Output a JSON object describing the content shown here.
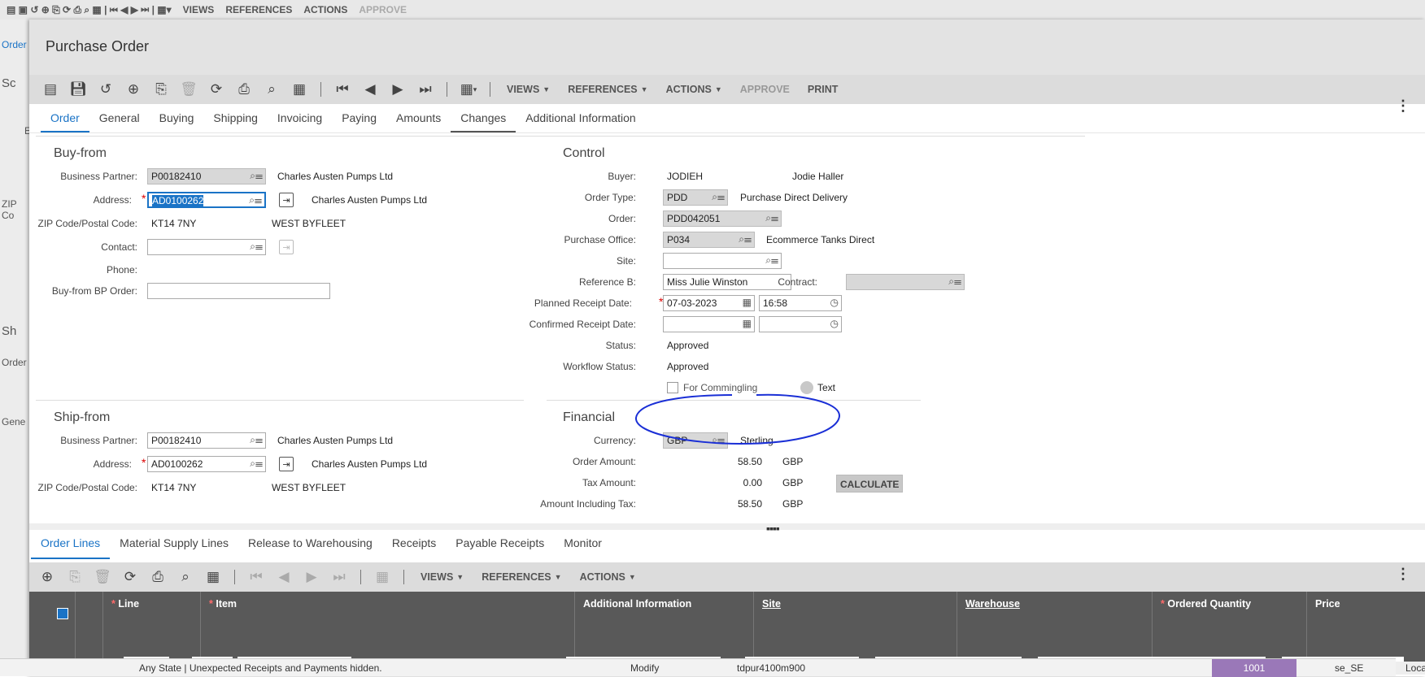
{
  "bg": {
    "toolbar": [
      "VIEWS",
      "REFERENCES",
      "ACTIONS",
      "APPROVE"
    ],
    "side": [
      "Order",
      "Sc",
      "E",
      "ZIP Co",
      "Sh",
      "Order",
      "Gene"
    ]
  },
  "dialog": {
    "title": "Purchase Order"
  },
  "toolbar": {
    "menus": [
      "VIEWS",
      "REFERENCES",
      "ACTIONS"
    ],
    "approve": "APPROVE",
    "print": "PRINT"
  },
  "tabs": [
    "Order",
    "General",
    "Buying",
    "Shipping",
    "Invoicing",
    "Paying",
    "Amounts",
    "Changes",
    "Additional Information"
  ],
  "buyfrom": {
    "title": "Buy-from",
    "bp_label": "Business Partner:",
    "bp": "P00182410",
    "bp_name": "Charles Austen Pumps Ltd",
    "addr_label": "Address:",
    "addr": "AD0100262",
    "addr_name": "Charles Austen Pumps Ltd",
    "zip_label": "ZIP Code/Postal Code:",
    "zip": "KT14 7NY",
    "city": "WEST BYFLEET",
    "contact_label": "Contact:",
    "phone_label": "Phone:",
    "order_label": "Buy-from BP Order:"
  },
  "control": {
    "title": "Control",
    "buyer_label": "Buyer:",
    "buyer": "JODIEH",
    "buyer_name": "Jodie Haller",
    "type_label": "Order Type:",
    "type": "PDD",
    "type_name": "Purchase Direct Delivery",
    "order_label": "Order:",
    "order": "PDD042051",
    "office_label": "Purchase Office:",
    "office": "P034",
    "office_name": "Ecommerce Tanks Direct",
    "site_label": "Site:",
    "ref_label": "Reference B:",
    "ref": "Miss Julie Winston",
    "contract_label": "Contract:",
    "prd_label": "Planned Receipt Date:",
    "prd": "07-03-2023",
    "prt": "16:58",
    "crd_label": "Confirmed Receipt Date:",
    "status_label": "Status:",
    "status": "Approved",
    "wf_label": "Workflow Status:",
    "wf": "Approved",
    "commingling": "For Commingling",
    "text": "Text"
  },
  "shipfrom": {
    "title": "Ship-from",
    "bp_label": "Business Partner:",
    "bp": "P00182410",
    "bp_name": "Charles Austen Pumps Ltd",
    "addr_label": "Address:",
    "addr": "AD0100262",
    "addr_name": "Charles Austen Pumps Ltd",
    "zip_label": "ZIP Code/Postal Code:",
    "zip": "KT14 7NY",
    "city": "WEST BYFLEET"
  },
  "financial": {
    "title": "Financial",
    "cur_label": "Currency:",
    "cur": "GBP",
    "cur_name": "Sterling",
    "oa_label": "Order Amount:",
    "oa": "58.50",
    "oa_cur": "GBP",
    "ta_label": "Tax Amount:",
    "ta": "0.00",
    "ta_cur": "GBP",
    "calc": "CALCULATE",
    "ai_label": "Amount Including Tax:",
    "ai": "58.50",
    "ai_cur": "GBP"
  },
  "bottom_tabs": [
    "Order Lines",
    "Material Supply Lines",
    "Release to Warehousing",
    "Receipts",
    "Payable Receipts",
    "Monitor"
  ],
  "bottom_toolbar": {
    "menus": [
      "VIEWS",
      "REFERENCES",
      "ACTIONS"
    ]
  },
  "grid": {
    "columns": [
      "Line",
      "Item",
      "Additional Information",
      "Site",
      "Warehouse",
      "Ordered Quantity",
      "Price"
    ]
  },
  "status": {
    "msg": "Any State | Unexpected Receipts and Payments hidden.",
    "mode": "Modify",
    "server": "tdpur4100m900",
    "company": "1001",
    "locale": "se_SE",
    "loc": "Loca"
  }
}
